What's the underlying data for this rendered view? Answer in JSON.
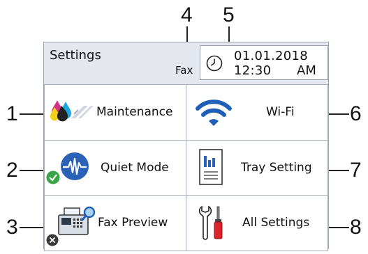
{
  "callouts": [
    "1",
    "2",
    "3",
    "4",
    "5",
    "6",
    "7",
    "8"
  ],
  "header": {
    "title": "Settings",
    "fax_label": "Fax",
    "date": "01.01.2018",
    "time": "12:30",
    "ampm": "AM"
  },
  "buttons": {
    "maintenance": "Maintenance",
    "wifi": "Wi-Fi",
    "quiet_mode": "Quiet Mode",
    "tray_setting": "Tray Setting",
    "fax_preview": "Fax Preview",
    "all_settings": "All Settings"
  },
  "icons": {
    "maintenance": "ink-drops-icon",
    "wifi": "wifi-icon",
    "quiet_mode": "quiet-mode-icon",
    "quiet_badge": "check-badge-icon",
    "tray_setting": "document-chart-icon",
    "fax_preview": "fax-machine-icon",
    "fax_badge": "x-badge-icon",
    "all_settings": "tools-icon",
    "clock": "clock-icon"
  },
  "colors": {
    "wifi": "#1f5fb8",
    "quiet_mode": "#2a62b8",
    "check_badge": "#37a346",
    "tools_red": "#d8242a"
  }
}
